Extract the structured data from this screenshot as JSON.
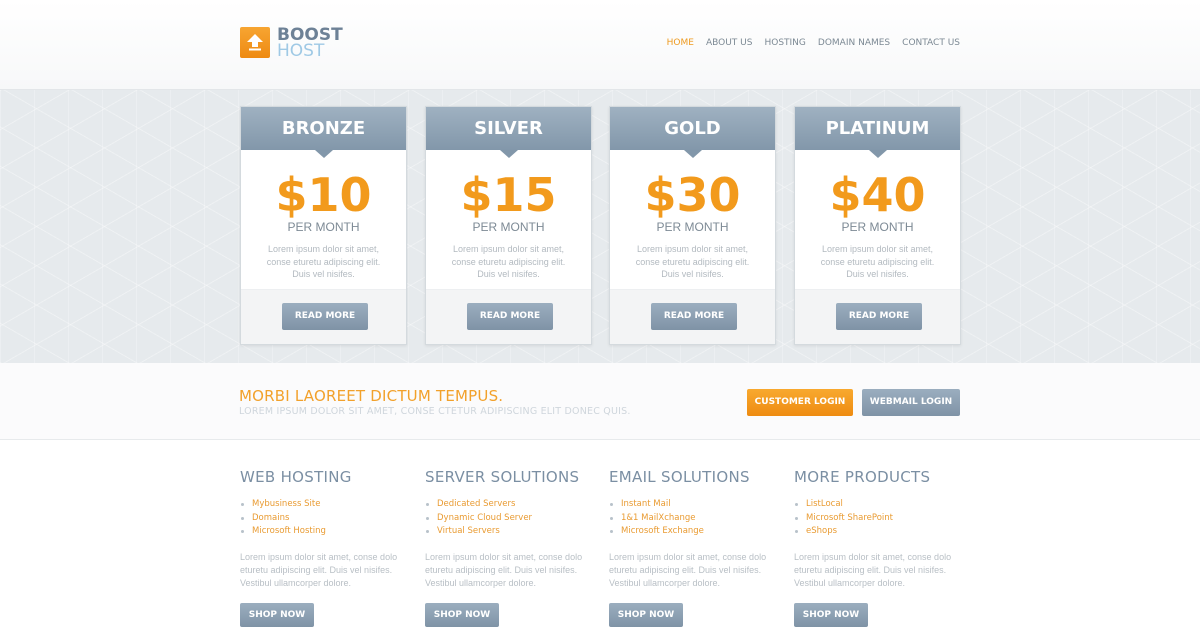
{
  "brand": {
    "line1": "BOOST",
    "line2": "HOST",
    "icon": "upload-arrow-icon",
    "accent": "#f29a1c"
  },
  "nav": {
    "items": [
      {
        "label": "HOME",
        "active": true
      },
      {
        "label": "ABOUT US"
      },
      {
        "label": "HOSTING"
      },
      {
        "label": "DOMAIN NAMES"
      },
      {
        "label": "CONTACT US"
      }
    ]
  },
  "plans": [
    {
      "name": "BRONZE",
      "price": "$10",
      "period": "PER MONTH",
      "desc": "Lorem ipsum dolor sit amet, conse eturetu adipiscing elit. Duis vel nisifes.",
      "button": "READ MORE"
    },
    {
      "name": "SILVER",
      "price": "$15",
      "period": "PER MONTH",
      "desc": "Lorem ipsum dolor sit amet, conse eturetu adipiscing elit. Duis vel nisifes.",
      "button": "READ MORE"
    },
    {
      "name": "GOLD",
      "price": "$30",
      "period": "PER MONTH",
      "desc": "Lorem ipsum dolor sit amet, conse eturetu adipiscing elit. Duis vel nisifes.",
      "button": "READ MORE"
    },
    {
      "name": "PLATINUM",
      "price": "$40",
      "period": "PER MONTH",
      "desc": "Lorem ipsum dolor sit amet, conse eturetu adipiscing elit. Duis vel nisifes.",
      "button": "READ MORE"
    }
  ],
  "cta": {
    "title": "MORBI LAOREET DICTUM TEMPUS.",
    "subtitle": "LOREM IPSUM DOLOR SIT AMET, CONSE CTETUR ADIPISCING ELIT DONEC QUIS.",
    "customer_login": "CUSTOMER LOGIN",
    "webmail_login": "WEBMAIL LOGIN"
  },
  "products": [
    {
      "title": "WEB HOSTING",
      "items": [
        "Mybusiness Site",
        "Domains",
        "Microsoft Hosting"
      ],
      "desc": "Lorem ipsum dolor sit amet, conse dolo eturetu adipiscing elit. Duis vel nisifes. Vestibul ullamcorper dolore.",
      "button": "SHOP NOW"
    },
    {
      "title": "SERVER SOLUTIONS",
      "items": [
        "Dedicated Servers",
        "Dynamic Cloud Server",
        "Virtual Servers"
      ],
      "desc": "Lorem ipsum dolor sit amet, conse dolo eturetu adipiscing elit. Duis vel nisifes. Vestibul ullamcorper dolore.",
      "button": "SHOP NOW"
    },
    {
      "title": "EMAIL SOLUTIONS",
      "items": [
        "Instant Mail",
        "1&1 MailXchange",
        "Microsoft Exchange"
      ],
      "desc": "Lorem ipsum dolor sit amet, conse dolo eturetu adipiscing elit. Duis vel nisifes. Vestibul ullamcorper dolore.",
      "button": "SHOP NOW"
    },
    {
      "title": "MORE PRODUCTS",
      "items": [
        "ListLocal",
        "Microsoft SharePoint",
        "eShops"
      ],
      "desc": "Lorem ipsum dolor sit amet, conse dolo eturetu adipiscing elit. Duis vel nisifes. Vestibul ullamcorper dolore.",
      "button": "SHOP NOW"
    }
  ]
}
